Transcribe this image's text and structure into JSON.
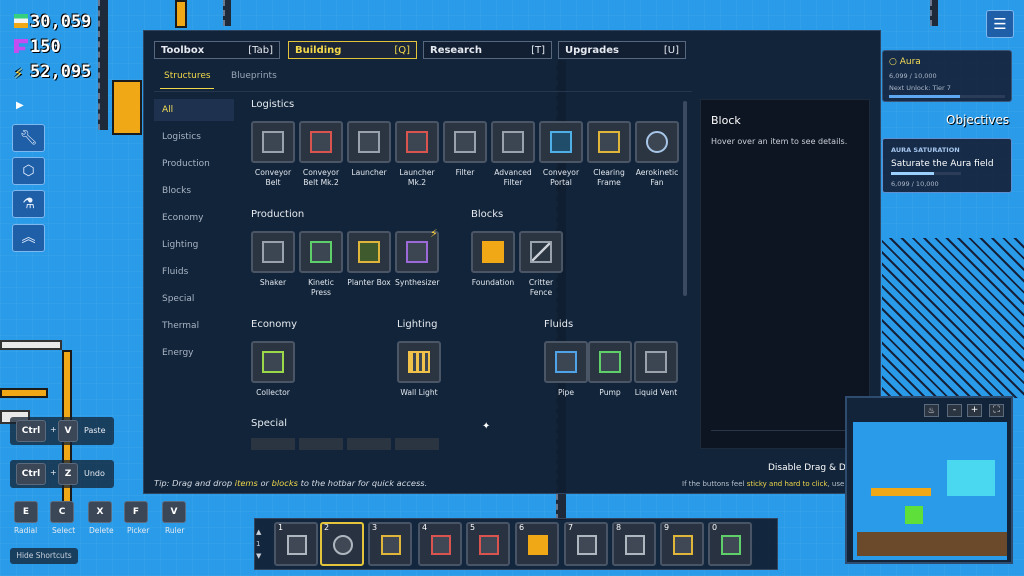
{
  "resources": {
    "cells": "30,059",
    "flux": "150",
    "power": "52,095"
  },
  "menu_icon": "hamburger-icon",
  "tabs": [
    {
      "label": "Toolbox",
      "key": "[Tab]"
    },
    {
      "label": "Building",
      "key": "[Q]"
    },
    {
      "label": "Research",
      "key": "[T]"
    },
    {
      "label": "Upgrades",
      "key": "[U]"
    }
  ],
  "subtabs": [
    "Structures",
    "Blueprints"
  ],
  "categories": [
    "All",
    "Logistics",
    "Production",
    "Blocks",
    "Economy",
    "Lighting",
    "Fluids",
    "Special",
    "Thermal",
    "Energy"
  ],
  "sections": {
    "logistics": {
      "title": "Logistics",
      "items": [
        "Conveyor Belt",
        "Conveyor Belt Mk.2",
        "Launcher",
        "Launcher Mk.2",
        "Filter",
        "Advanced Filter",
        "Conveyor Portal",
        "Clearing Frame",
        "Aerokinetic Fan"
      ]
    },
    "production": {
      "title": "Production",
      "items": [
        "Shaker",
        "Kinetic Press",
        "Planter Box",
        "Synthesizer"
      ]
    },
    "blocks": {
      "title": "Blocks",
      "items": [
        "Foundation",
        "Critter Fence"
      ]
    },
    "economy": {
      "title": "Economy",
      "items": [
        "Collector"
      ]
    },
    "lighting": {
      "title": "Lighting",
      "items": [
        "Wall Light"
      ]
    },
    "fluids": {
      "title": "Fluids",
      "items": [
        "Pipe",
        "Pump",
        "Liquid Vent"
      ]
    },
    "special": {
      "title": "Special"
    }
  },
  "detail": {
    "title": "Block",
    "text": "Hover over an item to see details."
  },
  "tip": {
    "prefix": "Tip: Drag and drop ",
    "items": "items",
    "or": " or ",
    "blocks": "blocks",
    "suffix": " to the hotbar for quick access."
  },
  "drag_toggle": {
    "label": "Disable Drag & Drop",
    "hint_pre": "If the buttons feel ",
    "hint_em": "sticky and hard to click",
    "hint_post": ", use this!"
  },
  "aura": {
    "title": "Aura",
    "value": "6,099 / 10,000",
    "next": "Next Unlock: Tier 7",
    "progress": 0.61
  },
  "objectives": {
    "title": "Objectives",
    "heading": "AURA SATURATION",
    "task": "Saturate the Aura field",
    "value": "6,099 / 10,000",
    "progress": 0.61
  },
  "shortcuts": {
    "paste": {
      "keys": [
        "Ctrl",
        "V"
      ],
      "label": "Paste"
    },
    "undo": {
      "keys": [
        "Ctrl",
        "Z"
      ],
      "label": "Undo"
    },
    "row": [
      {
        "key": "E",
        "label": "Radial"
      },
      {
        "key": "C",
        "label": "Select"
      },
      {
        "key": "X",
        "label": "Delete"
      },
      {
        "key": "F",
        "label": "Picker"
      },
      {
        "key": "V",
        "label": "Ruler"
      }
    ],
    "hide": "Hide Shortcuts"
  },
  "hotbar": [
    "1",
    "2",
    "3",
    "4",
    "5",
    "6",
    "7",
    "8",
    "9",
    "0"
  ],
  "map_controls": [
    "fire-icon",
    "minus-icon",
    "plus-icon",
    "fullscreen-icon"
  ],
  "colors": {
    "accent": "#f0d74a",
    "panel": "#101d30",
    "sky": "#2a9be8",
    "gold": "#f0a817"
  }
}
